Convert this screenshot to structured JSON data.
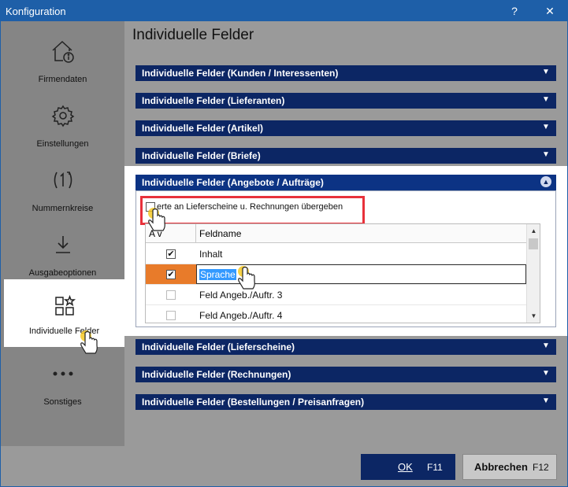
{
  "window": {
    "title": "Konfiguration",
    "help": "?",
    "close": "✕"
  },
  "sidebar": {
    "items": [
      {
        "label": "Firmendaten",
        "icon": "home-info-icon"
      },
      {
        "label": "Einstellungen",
        "icon": "gear-icon"
      },
      {
        "label": "Nummernkreise",
        "icon": "numbering-icon"
      },
      {
        "label": "Ausgabeoptionen",
        "icon": "download-icon"
      },
      {
        "label": "Individuelle Felder",
        "icon": "custom-fields-icon",
        "active": true
      },
      {
        "label": "Sonstiges",
        "icon": "more-icon"
      }
    ]
  },
  "main": {
    "title": "Individuelle Felder",
    "sections": [
      {
        "label": "Individuelle Felder (Kunden / Interessenten)"
      },
      {
        "label": "Individuelle Felder (Lieferanten)"
      },
      {
        "label": "Individuelle Felder (Artikel)"
      },
      {
        "label": "Individuelle Felder (Briefe)"
      },
      {
        "label": "Individuelle Felder (Angebote / Aufträge)",
        "expanded": true
      },
      {
        "label": "Individuelle Felder (Lieferscheine)"
      },
      {
        "label": "Individuelle Felder (Rechnungen)"
      },
      {
        "label": "Individuelle Felder (Bestellungen / Preisanfragen)"
      }
    ],
    "expanded": {
      "copy_option": "Werte an Lieferscheine u. Rechnungen übergeben",
      "copy_option_visible_text": "erte an Lieferscheine u. Rechnungen übergeben",
      "grid": {
        "col_active": "Aktiv",
        "col_active_visible": "A     v",
        "col_name": "Feldname",
        "rows": [
          {
            "active": true,
            "name": "Inhalt"
          },
          {
            "active": true,
            "name": "Sprache",
            "selected": true
          },
          {
            "active": false,
            "name": "Feld Angeb./Auftr. 3"
          },
          {
            "active": false,
            "name": "Feld Angeb./Auftr. 4"
          }
        ]
      }
    }
  },
  "footer": {
    "ok": {
      "label": "OK",
      "key": "F11"
    },
    "cancel": {
      "label": "Abbrechen",
      "key": "F12"
    }
  },
  "colors": {
    "titlebar": "#1e5fa8",
    "section_header": "#0c2664",
    "selection_orange": "#e87b2a",
    "highlight_red": "#e8313a"
  }
}
